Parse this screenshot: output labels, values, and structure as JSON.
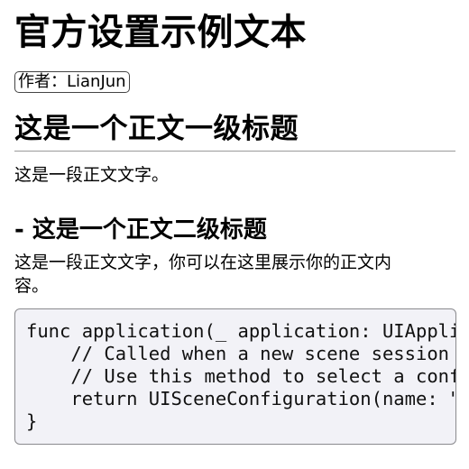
{
  "document": {
    "title": "官方设置示例文本",
    "author_badge": "作者：LianJun",
    "heading1": "这是一个正文一级标题",
    "paragraph1": "这是一段正文文字。",
    "heading2": "- 这是一个正文二级标题",
    "paragraph2": "这是一段正文文字，你可以在这里展示你的正文内容。"
  },
  "code": {
    "lines": [
      "func application(_ application: UIApplication, configurationForConnecting connectingSceneSession: UISceneSession, options: UIScene.ConnectionOptions) -> UISceneConfiguration {",
      "    // Called when a new scene session is being created.",
      "    // Use this method to select a configuration to create the new scene with.",
      "    return UISceneConfiguration(name: \"Default Configuration\", sessionRole: connectingSceneSession.role)",
      "}"
    ]
  }
}
